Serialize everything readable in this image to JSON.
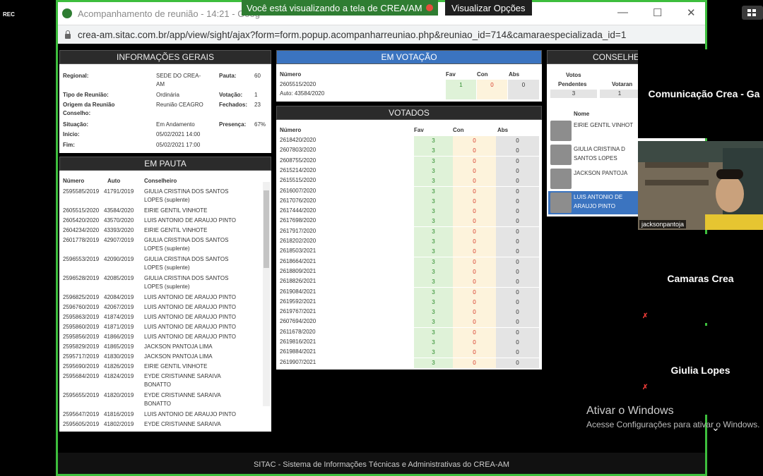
{
  "rec": "REC",
  "share_bar": {
    "text": "Você está visualizando a tela de CREA/AM",
    "options": "Visualizar Opções"
  },
  "browser": {
    "title": "Acompanhamento de reunião - 14:21 - Goog",
    "url": "crea-am.sitac.com.br/app/view/sight/ajax?form=form.popup.acompanharreuniao.php&reuniao_id=714&camaraespecializada_id=1"
  },
  "info": {
    "title": "INFORMAÇÕES GERAIS",
    "regional_label": "Regional:",
    "regional_value_l1": "SEDE DO CREA-",
    "regional_value_l2": "AM",
    "pauta_label": "Pauta:",
    "pauta_value": "60",
    "tipo_label": "Tipo de Reunião:",
    "tipo_value": "Ordinária",
    "votacao_label": "Votação:",
    "votacao_value": "1",
    "origem_label_l1": "Origem da Reunião",
    "origem_label_l2": "Conselho:",
    "origem_value": "Reunião CEAGRO",
    "fechados_label": "Fechados:",
    "fechados_value": "23",
    "situacao_label": "Situação:",
    "situacao_value": "Em Andamento",
    "presenca_label": "Presença:",
    "presenca_value": "67%",
    "inicio_label": "Inicio:",
    "inicio_value": "05/02/2021 14:00",
    "fim_label": "Fim:",
    "fim_value": "05/02/2021 17:00"
  },
  "pauta": {
    "title": "EM PAUTA",
    "headers": [
      "Número",
      "Auto",
      "Conselheiro"
    ],
    "rows": [
      [
        "2595585/2019",
        "41791/2019",
        "GIULIA CRISTINA DOS SANTOS",
        "LOPES (suplente)"
      ],
      [
        "2605515/2020",
        "43584/2020",
        "EIRIE GENTIL VINHOTE",
        ""
      ],
      [
        "2605420/2020",
        "43570/2020",
        "LUIS ANTONIO DE ARAUJO PINTO",
        ""
      ],
      [
        "2604234/2020",
        "43393/2020",
        "EIRIE GENTIL VINHOTE",
        ""
      ],
      [
        "2601778/2019",
        "42907/2019",
        "GIULIA CRISTINA DOS SANTOS",
        "LOPES (suplente)"
      ],
      [
        "2596553/2019",
        "42090/2019",
        "GIULIA CRISTINA DOS SANTOS",
        "LOPES (suplente)"
      ],
      [
        "2596528/2019",
        "42085/2019",
        "GIULIA CRISTINA DOS SANTOS",
        "LOPES (suplente)"
      ],
      [
        "2596825/2019",
        "42084/2019",
        "LUIS ANTONIO DE ARAUJO PINTO",
        ""
      ],
      [
        "2596760/2019",
        "42067/2019",
        "LUIS ANTONIO DE ARAUJO PINTO",
        ""
      ],
      [
        "2595863/2019",
        "41874/2019",
        "LUIS ANTONIO DE ARAUJO PINTO",
        ""
      ],
      [
        "2595860/2019",
        "41871/2019",
        "LUIS ANTONIO DE ARAUJO PINTO",
        ""
      ],
      [
        "2595856/2019",
        "41866/2019",
        "LUIS ANTONIO DE ARAUJO PINTO",
        ""
      ],
      [
        "2595829/2019",
        "41865/2019",
        "JACKSON PANTOJA LIMA",
        ""
      ],
      [
        "2595717/2019",
        "41830/2019",
        "JACKSON PANTOJA LIMA",
        ""
      ],
      [
        "2595690/2019",
        "41826/2019",
        "EIRIE GENTIL VINHOTE",
        ""
      ],
      [
        "2595684/2019",
        "41824/2019",
        "EYDE CRISTIANNE SARAIVA",
        "BONATTO"
      ],
      [
        "2595655/2019",
        "41820/2019",
        "EYDE CRISTIANNE SARAIVA",
        "BONATTO"
      ],
      [
        "2595647/2019",
        "41816/2019",
        "LUIS ANTONIO DE ARAUJO PINTO",
        ""
      ],
      [
        "2595605/2019",
        "41802/2019",
        "EYDE CRISTIANNE SARAIVA",
        ""
      ]
    ]
  },
  "votacao": {
    "title": "EM VOTAÇÃO",
    "headers": [
      "Número",
      "Fav",
      "Con",
      "Abs"
    ],
    "numero": "2605515/2020",
    "auto": "Auto: 43584/2020",
    "fav": "1",
    "con": "0",
    "abs": "0"
  },
  "votados": {
    "title": "VOTADOS",
    "headers": [
      "Número",
      "Fav",
      "Con",
      "Abs"
    ],
    "rows": [
      [
        "2618420/2020",
        "3",
        "0",
        "0"
      ],
      [
        "2607803/2020",
        "3",
        "0",
        "0"
      ],
      [
        "2608755/2020",
        "3",
        "0",
        "0"
      ],
      [
        "2615214/2020",
        "3",
        "0",
        "0"
      ],
      [
        "2615515/2020",
        "3",
        "0",
        "0"
      ],
      [
        "2616007/2020",
        "3",
        "0",
        "0"
      ],
      [
        "2617076/2020",
        "3",
        "0",
        "0"
      ],
      [
        "2617444/2020",
        "3",
        "0",
        "0"
      ],
      [
        "2617698/2020",
        "3",
        "0",
        "0"
      ],
      [
        "2617917/2020",
        "3",
        "0",
        "0"
      ],
      [
        "2618202/2020",
        "3",
        "0",
        "0"
      ],
      [
        "2618503/2021",
        "3",
        "0",
        "0"
      ],
      [
        "2618664/2021",
        "3",
        "0",
        "0"
      ],
      [
        "2618809/2021",
        "3",
        "0",
        "0"
      ],
      [
        "2618826/2021",
        "3",
        "0",
        "0"
      ],
      [
        "2619084/2021",
        "3",
        "0",
        "0"
      ],
      [
        "2619592/2021",
        "3",
        "0",
        "0"
      ],
      [
        "2619767/2021",
        "3",
        "0",
        "0"
      ],
      [
        "2607694/2020",
        "3",
        "0",
        "0"
      ],
      [
        "2611678/2020",
        "3",
        "0",
        "0"
      ],
      [
        "2619816/2021",
        "3",
        "0",
        "0"
      ],
      [
        "2619884/2021",
        "3",
        "0",
        "0"
      ],
      [
        "2619907/2021",
        "3",
        "0",
        "0"
      ]
    ]
  },
  "conselheiros": {
    "title": "CONSELHE",
    "votos_label": "Votos",
    "pendentes_label": "Pendentes",
    "votaram_label": "Votaran",
    "pendentes_value": "3",
    "votaram_value": "1",
    "nome_label": "Nome",
    "members": [
      {
        "l1": "EIRIE GENTIL VINHOT",
        "l2": ""
      },
      {
        "l1": "GIULIA CRISTINA D",
        "l2": "SANTOS LOPES"
      },
      {
        "l1": "JACKSON PANTOJA",
        "l2": ""
      },
      {
        "l1": "LUIS ANTONIO DE",
        "l2": "ARAUJO PINTO"
      }
    ]
  },
  "footer": "SITAC - Sistema de Informações Técnicas e Administrativas do CREA-AM",
  "participants": {
    "t1": "Comunicação Crea - Ga",
    "t2_name": "jacksonpantoja",
    "t3": "Camaras Crea",
    "t4": "Giulia Lopes"
  },
  "watermark": {
    "l1": "Ativar o Windows",
    "l2": "Acesse Configurações para ativar o Windows."
  }
}
